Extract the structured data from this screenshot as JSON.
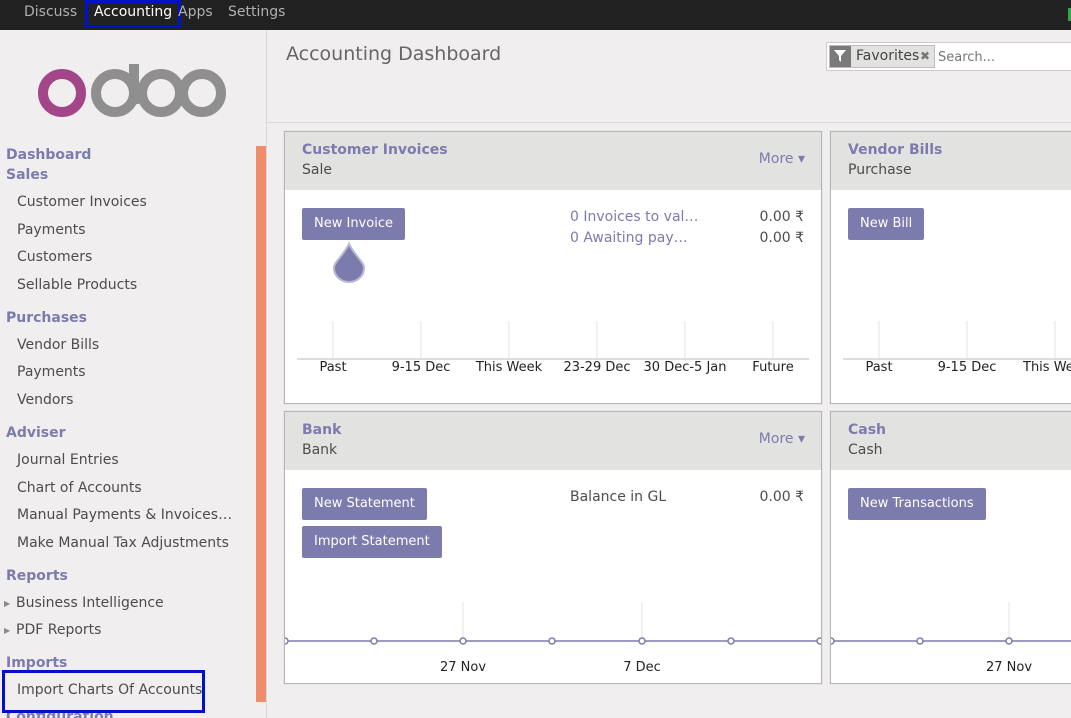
{
  "topbar": {
    "menus": [
      "Discuss",
      "Accounting",
      "Apps",
      "Settings"
    ],
    "active": "Accounting"
  },
  "sidebar": {
    "logo_text": "odoo",
    "sections": [
      {
        "title": "Dashboard"
      },
      {
        "title": "Sales",
        "items": [
          "Customer Invoices",
          "Payments",
          "Customers",
          "Sellable Products"
        ]
      },
      {
        "title": "Purchases",
        "items": [
          "Vendor Bills",
          "Payments",
          "Vendors"
        ]
      },
      {
        "title": "Adviser",
        "items": [
          "Journal Entries",
          "Chart of Accounts",
          "Manual Payments & Invoices…",
          "Make Manual Tax Adjustments"
        ]
      },
      {
        "title": "Reports",
        "items": [
          "Business Intelligence",
          "PDF Reports"
        ]
      },
      {
        "title": "Imports",
        "items": [
          "Import Charts Of Accounts"
        ]
      },
      {
        "title": "Configuration"
      }
    ]
  },
  "header": {
    "title": "Accounting Dashboard",
    "search": {
      "facet": "Favorites",
      "placeholder": "Search..."
    }
  },
  "cards": {
    "customer_invoices": {
      "title": "Customer Invoices",
      "subtitle": "Sale",
      "more": "More",
      "button": "New Invoice",
      "links": [
        "0 Invoices to val…",
        "0 Awaiting pay…"
      ],
      "amounts": [
        "0.00 ₹",
        "0.00 ₹"
      ],
      "axis": [
        "Past",
        "9-15 Dec",
        "This Week",
        "23-29 Dec",
        "30 Dec-5 Jan",
        "Future"
      ]
    },
    "vendor_bills": {
      "title": "Vendor Bills",
      "subtitle": "Purchase",
      "button": "New Bill",
      "axis": [
        "Past",
        "9-15 Dec",
        "This We"
      ]
    },
    "bank": {
      "title": "Bank",
      "subtitle": "Bank",
      "more": "More",
      "buttons": [
        "New Statement",
        "Import Statement"
      ],
      "balance_label": "Balance in GL",
      "balance_amount": "0.00 ₹",
      "axis": [
        "27 Nov",
        "7 Dec"
      ]
    },
    "cash": {
      "title": "Cash",
      "subtitle": "Cash",
      "button": "New Transactions",
      "axis": [
        "27 Nov"
      ]
    }
  },
  "colors": {
    "accent": "#7c7bad",
    "topbar": "#212121",
    "scroll": "#ef8c6a",
    "highlight": "#0011cc"
  }
}
